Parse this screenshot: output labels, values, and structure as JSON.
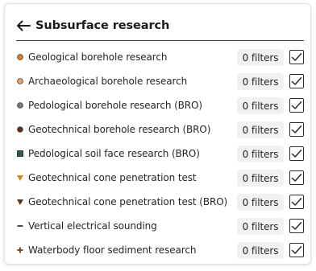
{
  "header": {
    "back_icon": "arrow-left-icon",
    "title": "Subsurface research"
  },
  "layers": [
    {
      "label": "Geological borehole research",
      "filters": "0 filters",
      "checked": true,
      "symbol": "circle",
      "color": "#d9822b"
    },
    {
      "label": "Archaeological borehole research",
      "filters": "0 filters",
      "checked": true,
      "symbol": "circle",
      "color": "#e8a75c"
    },
    {
      "label": "Pedological borehole research (BRO)",
      "filters": "0 filters",
      "checked": true,
      "symbol": "circle",
      "color": "#7a7a7a"
    },
    {
      "label": "Geotechnical borehole research (BRO)",
      "filters": "0 filters",
      "checked": true,
      "symbol": "circle",
      "color": "#6b2a1e"
    },
    {
      "label": "Pedological soil face research (BRO)",
      "filters": "0 filters",
      "checked": true,
      "symbol": "square",
      "color": "#2f5e3a"
    },
    {
      "label": "Geotechnical cone penetration test",
      "filters": "0 filters",
      "checked": true,
      "symbol": "triangle-down",
      "color": "#c98a2a"
    },
    {
      "label": "Geotechnical cone penetration test (BRO)",
      "filters": "0 filters",
      "checked": true,
      "symbol": "triangle-down",
      "color": "#5a3a1c"
    },
    {
      "label": "Vertical electrical sounding",
      "filters": "0 filters",
      "checked": true,
      "symbol": "dash",
      "color": "#1f1f1f"
    },
    {
      "label": "Waterbody floor sediment research",
      "filters": "0 filters",
      "checked": true,
      "symbol": "plus",
      "color": "#7a4a2a"
    }
  ]
}
